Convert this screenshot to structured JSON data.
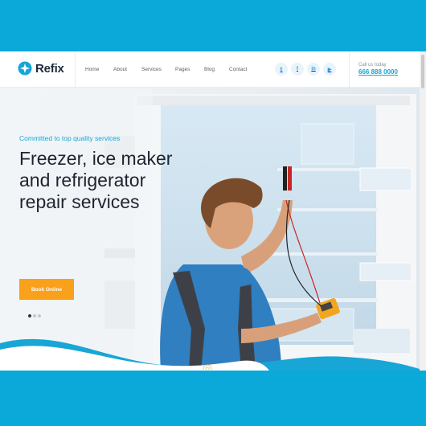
{
  "header": {
    "logo_text": "Refix",
    "nav": [
      "Home",
      "About",
      "Services",
      "Pages",
      "Blog",
      "Contact"
    ],
    "socials": [
      {
        "name": "twitter-icon",
        "glyph": "𝕥"
      },
      {
        "name": "facebook-icon",
        "glyph": "f"
      },
      {
        "name": "linkedin-icon",
        "glyph": "in"
      },
      {
        "name": "youtube-icon",
        "glyph": "▶"
      }
    ],
    "call_label": "Call us today",
    "call_number": "666 888 0000"
  },
  "hero": {
    "subtitle": "Committed to top quality services",
    "title": "Freezer, ice maker and refrigerator repair services",
    "button_label": "Book Online",
    "slides": 3,
    "active_slide": 1
  },
  "colors": {
    "accent": "#17a6d6",
    "button": "#f9a11b",
    "background": "#0aa9d9"
  }
}
